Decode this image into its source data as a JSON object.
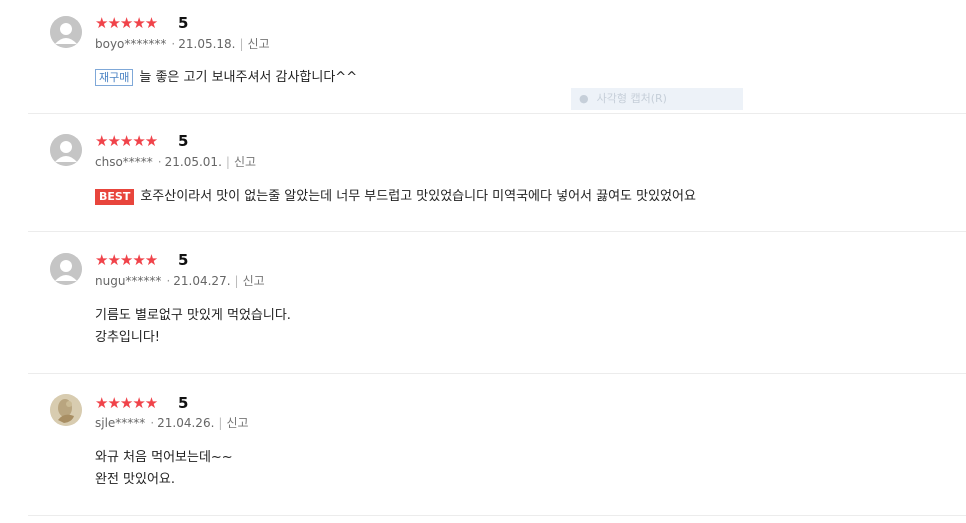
{
  "reviews": [
    {
      "stars": "★★★★★",
      "score": "5",
      "user": "boyo*******",
      "date": "21.05.18.",
      "report": "신고",
      "tag": "재구매",
      "tag_type": "rebuy",
      "lines": [
        "늘 좋은 고기 보내주셔서 감사합니다^^"
      ],
      "avatar": "default-avatar"
    },
    {
      "stars": "★★★★★",
      "score": "5",
      "user": "chso*****",
      "date": "21.05.01.",
      "report": "신고",
      "tag": "BEST",
      "tag_type": "best",
      "lines": [
        "호주산이라서 맛이 없는줄 알았는데  너무 부드럽고 맛있었습니다 미역국에다  넣어서 끓여도 맛있었어요"
      ],
      "avatar": "default-avatar"
    },
    {
      "stars": "★★★★★",
      "score": "5",
      "user": "nugu******",
      "date": "21.04.27.",
      "report": "신고",
      "lines": [
        "기름도 별로없구 맛있게 먹었습니다.",
        "강추입니다!"
      ],
      "avatar": "default-avatar"
    },
    {
      "stars": "★★★★★",
      "score": "5",
      "user": "sjle*****",
      "date": "21.04.26.",
      "report": "신고",
      "lines": [
        "와규 처음 먹어보는데~~",
        "완전 맛있어요."
      ],
      "avatar": "photo-avatar"
    }
  ],
  "capture_hint": "사각형 캡처(R)",
  "colors": {
    "star": "#f0434a",
    "best_tag": "#e8453c",
    "rebuy_tag": "#4a82c3"
  }
}
